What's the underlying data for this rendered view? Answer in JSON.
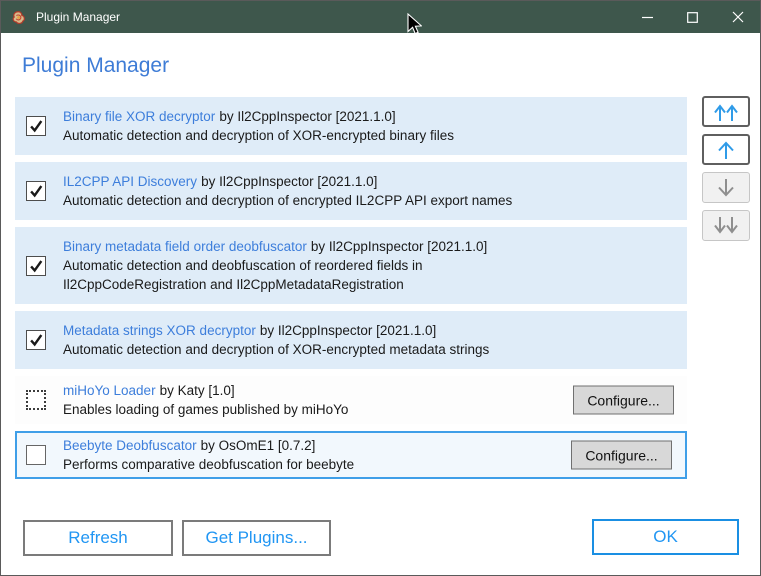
{
  "titlebar": {
    "title": "Plugin Manager"
  },
  "heading": "Plugin Manager",
  "plugins": [
    {
      "name": "Binary file XOR decryptor",
      "byline": "by Il2CppInspector [2021.1.0]",
      "description": "Automatic detection and decryption of XOR-encrypted binary files",
      "state": "checked",
      "selected": false,
      "configure_label": null
    },
    {
      "name": "IL2CPP API Discovery",
      "byline": "by Il2CppInspector [2021.1.0]",
      "description": "Automatic detection and decryption of encrypted IL2CPP API export names",
      "state": "checked",
      "selected": false,
      "configure_label": null
    },
    {
      "name": "Binary metadata field order deobfuscator",
      "byline": "by Il2CppInspector [2021.1.0]",
      "description": "Automatic detection and deobfuscation of reordered fields in\nIl2CppCodeRegistration and Il2CppMetadataRegistration",
      "state": "checked",
      "selected": false,
      "configure_label": null
    },
    {
      "name": "Metadata strings XOR decryptor",
      "byline": "by Il2CppInspector [2021.1.0]",
      "description": "Automatic detection and decryption of XOR-encrypted metadata strings",
      "state": "checked",
      "selected": false,
      "configure_label": null
    },
    {
      "name": "miHoYo Loader",
      "byline": "by Katy [1.0]",
      "description": "Enables loading of games published by miHoYo",
      "state": "indeterminate",
      "selected": false,
      "configure_label": "Configure..."
    },
    {
      "name": "Beebyte Deobfuscator",
      "byline": "by OsOmE1 [0.7.2]",
      "description": "Performs comparative deobfuscation for beebyte",
      "state": "unchecked",
      "selected": true,
      "configure_label": "Configure..."
    }
  ],
  "reorder_buttons": [
    {
      "id": "move-to-top",
      "icon": "double-arrow-up-icon",
      "enabled": true
    },
    {
      "id": "move-up",
      "icon": "arrow-up-icon",
      "enabled": true
    },
    {
      "id": "move-down",
      "icon": "arrow-down-icon",
      "enabled": false
    },
    {
      "id": "move-to-bottom",
      "icon": "double-arrow-down-icon",
      "enabled": false
    }
  ],
  "footer": {
    "refresh": "Refresh",
    "get_plugins": "Get Plugins...",
    "ok": "OK"
  },
  "colors": {
    "titlebar_bg": "#3E574C",
    "heading_blue": "#3E7CD6",
    "link_blue": "#3D7EDB",
    "row_enabled_bg": "#DFECF8",
    "selected_border": "#3F9FE8",
    "selected_bg": "#F2F8FD",
    "action_blue": "#2196F3",
    "ok_border": "#1A8FE3",
    "configure_bg": "#D8D8D8",
    "arrow_enabled": "#2F9BE8",
    "arrow_disabled": "#8F8F8F"
  }
}
